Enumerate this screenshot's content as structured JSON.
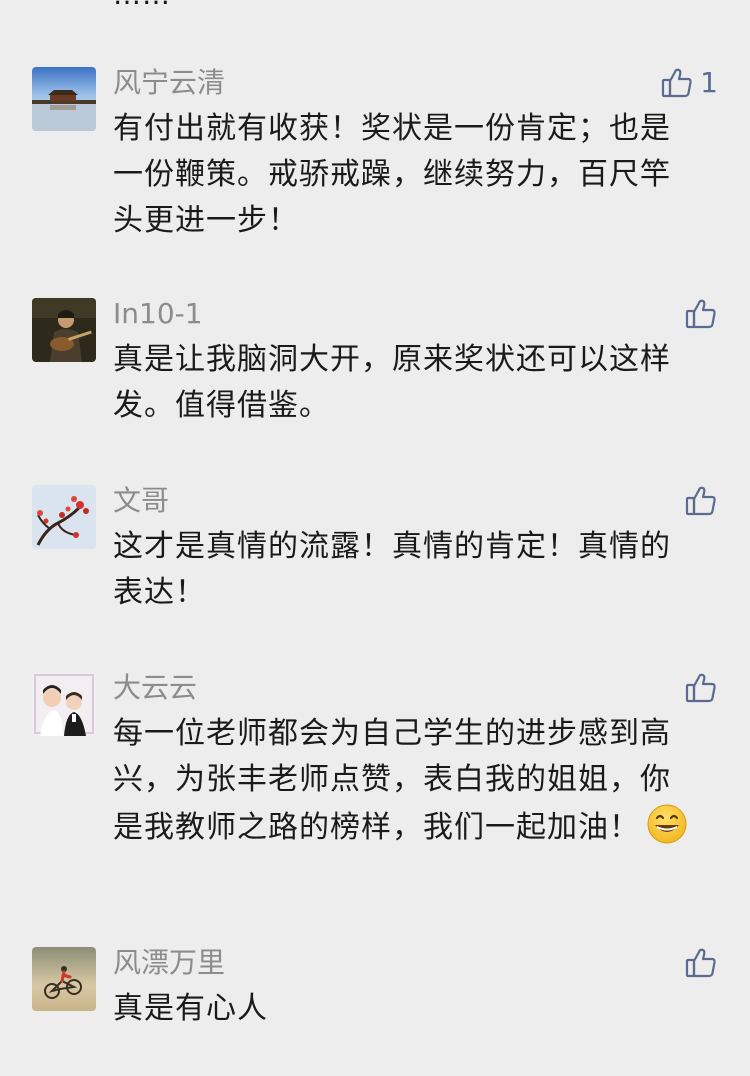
{
  "top_fragment": "……",
  "comments": [
    {
      "name": "风宁云清",
      "content": "有付出就有收获！奖状是一份肯定；也是一份鞭策。戒骄戒躁，继续努力，百尺竿头更进一步！",
      "likes": "1",
      "avatar_icon": "palace-lake-avatar"
    },
    {
      "name": "In10-1",
      "content": "真是让我脑洞大开，原来奖状还可以这样发。值得借鉴。",
      "likes": "",
      "avatar_icon": "guitarist-avatar"
    },
    {
      "name": "文哥",
      "content": "这才是真情的流露！真情的肯定！真情的表达！",
      "likes": "",
      "avatar_icon": "red-blossom-tree-avatar"
    },
    {
      "name": "大云云",
      "content": "每一位老师都会为自己学生的进步感到高兴，为张丰老师点赞，表白我的姐姐，你是我教师之路的榜样，我们一起加油！",
      "emoji": "grinning-face-emoji",
      "likes": "",
      "avatar_icon": "mother-child-avatar"
    },
    {
      "name": "风漂万里",
      "content": "真是有心人",
      "likes": "",
      "avatar_icon": "cyclist-sunset-avatar"
    }
  ],
  "colors": {
    "background": "#ededed",
    "name": "#8c8c8c",
    "content": "#1a1a1a",
    "like_icon": "#5b6a91"
  }
}
